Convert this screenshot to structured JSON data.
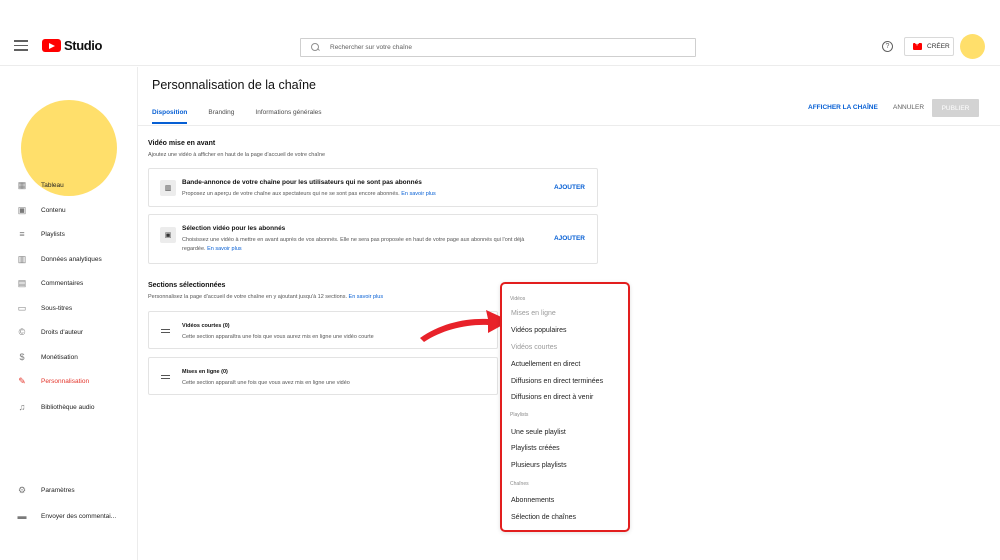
{
  "header": {
    "logo_text": "Studio",
    "search_placeholder": "Rechercher sur votre chaîne",
    "help_glyph": "?",
    "create_label": "CRÉER"
  },
  "sidebar": {
    "items": [
      {
        "label": "Tableau",
        "icon": "dashboard-icon",
        "glyph": "▦"
      },
      {
        "label": "Contenu",
        "icon": "content-icon",
        "glyph": "▣"
      },
      {
        "label": "Playlists",
        "icon": "playlist-icon",
        "glyph": "≡"
      },
      {
        "label": "Données analytiques",
        "icon": "analytics-icon",
        "glyph": "▥"
      },
      {
        "label": "Commentaires",
        "icon": "comments-icon",
        "glyph": "▤"
      },
      {
        "label": "Sous-titres",
        "icon": "subtitles-icon",
        "glyph": "▭"
      },
      {
        "label": "Droits d'auteur",
        "icon": "copyright-icon",
        "glyph": "©"
      },
      {
        "label": "Monétisation",
        "icon": "dollar-icon",
        "glyph": "$"
      },
      {
        "label": "Personnalisation",
        "icon": "magic-wand-icon",
        "glyph": "✎"
      },
      {
        "label": "Bibliothèque audio",
        "icon": "audio-library-icon",
        "glyph": "♫"
      }
    ],
    "settings": {
      "label": "Paramètres",
      "icon": "gear-icon",
      "glyph": "⚙"
    },
    "feedback": {
      "label": "Envoyer des commentai...",
      "icon": "feedback-icon",
      "glyph": "▬"
    }
  },
  "main": {
    "title": "Personnalisation de la chaîne",
    "tabs": [
      {
        "label": "Disposition",
        "active": true
      },
      {
        "label": "Branding",
        "active": false
      },
      {
        "label": "Informations générales",
        "active": false
      }
    ],
    "actions": {
      "view_channel": "AFFICHER LA CHAÎNE",
      "cancel": "ANNULER",
      "publish": "PUBLIER"
    },
    "featured": {
      "title": "Vidéo mise en avant",
      "desc": "Ajoutez une vidéo à afficher en haut de la page d'accueil de votre chaîne",
      "cards": [
        {
          "title": "Bande-annonce de votre chaîne pour les utilisateurs qui ne sont pas abonnés",
          "desc": "Proposez un aperçu de votre chaîne aux spectateurs qui ne se sont pas encore abonnés.",
          "link": "En savoir plus",
          "button": "AJOUTER"
        },
        {
          "title": "Sélection vidéo pour les abonnés",
          "desc": "Choisissez une vidéo à mettre en avant auprès de vos abonnés. Elle ne sera pas proposée en haut de votre page aux abonnés qui l'ont déjà regardée.",
          "link": "En savoir plus",
          "button": "AJOUTER"
        }
      ]
    },
    "sections": {
      "title": "Sections sélectionnées",
      "desc": "Personnalisez la page d'accueil de votre chaîne en y ajoutant jusqu'à 12 sections.",
      "link": "En savoir plus",
      "items": [
        {
          "title": "Vidéos courtes (0)",
          "desc": "Cette section apparaîtra une fois que vous aurez mis en ligne une vidéo courte"
        },
        {
          "title": "Mises en ligne (0)",
          "desc": "Cette section apparaît une fois que vous avez mis en ligne une vidéo"
        }
      ]
    }
  },
  "dropdown": {
    "groups": [
      {
        "label": "Vidéos",
        "items": [
          {
            "label": "Mises en ligne",
            "disabled": true
          },
          {
            "label": "Vidéos populaires",
            "disabled": false
          },
          {
            "label": "Vidéos courtes",
            "disabled": true
          },
          {
            "label": "Actuellement en direct",
            "disabled": false
          },
          {
            "label": "Diffusions en direct terminées",
            "disabled": false
          },
          {
            "label": "Diffusions en direct à venir",
            "disabled": false
          }
        ]
      },
      {
        "label": "Playlists",
        "items": [
          {
            "label": "Une seule playlist",
            "disabled": false
          },
          {
            "label": "Playlists créées",
            "disabled": false
          },
          {
            "label": "Plusieurs playlists",
            "disabled": false
          }
        ]
      },
      {
        "label": "Chaînes",
        "items": [
          {
            "label": "Abonnements",
            "disabled": false
          },
          {
            "label": "Sélection de chaînes",
            "disabled": false
          }
        ]
      }
    ]
  },
  "colors": {
    "accent_blue": "#065fd4",
    "brand_red": "#ff0000",
    "highlight_red": "#e21e1e",
    "avatar_yellow": "#ffdf6b",
    "active_nav": "#e4352b"
  }
}
